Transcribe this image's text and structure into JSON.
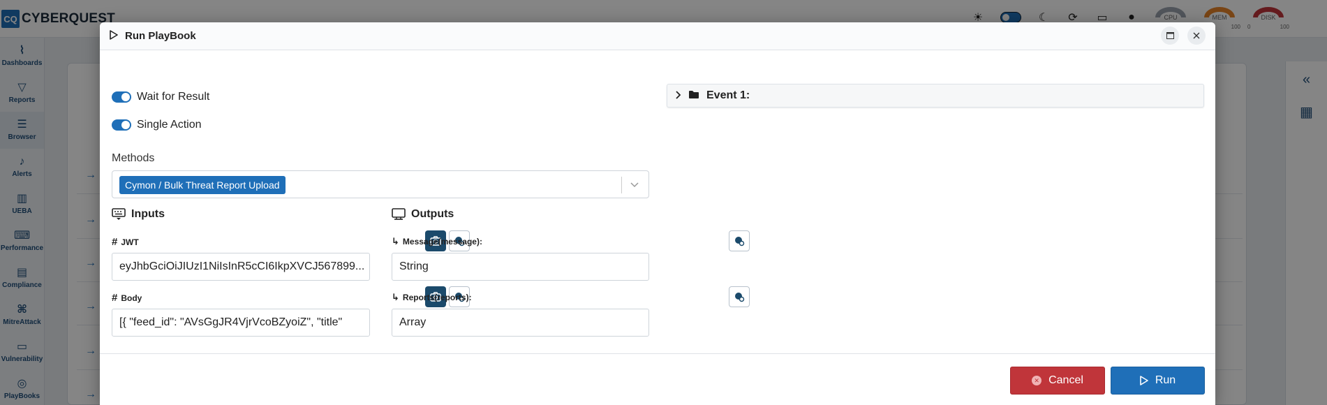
{
  "app": {
    "logo_mark": "CQ",
    "logo_text": "CYBERQUEST"
  },
  "topbar": {
    "gauges": [
      {
        "label": "CPU",
        "min": "",
        "max": "",
        "color": "#9ca3af"
      },
      {
        "label": "MEM",
        "min": "",
        "max": "100",
        "color": "#e8842a"
      },
      {
        "label": "DISK",
        "min": "0",
        "max": "100",
        "color": "#c0353a"
      }
    ]
  },
  "sidebar": {
    "items": [
      {
        "label": "Dashboards",
        "icon": "chart-line-icon"
      },
      {
        "label": "Reports",
        "icon": "filter-icon"
      },
      {
        "label": "Browser",
        "icon": "list-icon"
      },
      {
        "label": "Alerts",
        "icon": "bell-icon"
      },
      {
        "label": "UEBA",
        "icon": "chart-bar-icon"
      },
      {
        "label": "Performance",
        "icon": "keyboard-icon"
      },
      {
        "label": "Compliance",
        "icon": "file-check-icon"
      },
      {
        "label": "MitreAttack",
        "icon": "network-icon"
      },
      {
        "label": "Vulnerability",
        "icon": "server-icon"
      },
      {
        "label": "PlayBooks",
        "icon": "playbook-icon"
      }
    ]
  },
  "modal": {
    "title": "Run PlayBook",
    "wait_for_result": {
      "label": "Wait for Result",
      "on": true
    },
    "single_action": {
      "label": "Single Action",
      "on": true
    },
    "methods": {
      "label": "Methods",
      "selected": "Cymon / Bulk Threat Report Upload"
    },
    "inputs": {
      "title": "Inputs",
      "fields": [
        {
          "label": "JWT",
          "value": "eyJhbGciOiJIUzI1NiIsInR5cCI6IkpXVCJ567899..."
        },
        {
          "label": "Body",
          "value": "[{     \"feed_id\": \"AVsGgJR4VjrVcoBZyoiZ\",     \"title\""
        }
      ]
    },
    "outputs": {
      "title": "Outputs",
      "fields": [
        {
          "label": "Message(message):",
          "value": "String"
        },
        {
          "label": "Reports(reports):",
          "value": "Array"
        }
      ]
    },
    "event": {
      "title": "Event 1:"
    },
    "footer": {
      "cancel_label": "Cancel",
      "run_label": "Run"
    }
  },
  "colors": {
    "primary": "#1f6fb8",
    "danger": "#c0353a",
    "dark_button": "#1b4a6b"
  }
}
